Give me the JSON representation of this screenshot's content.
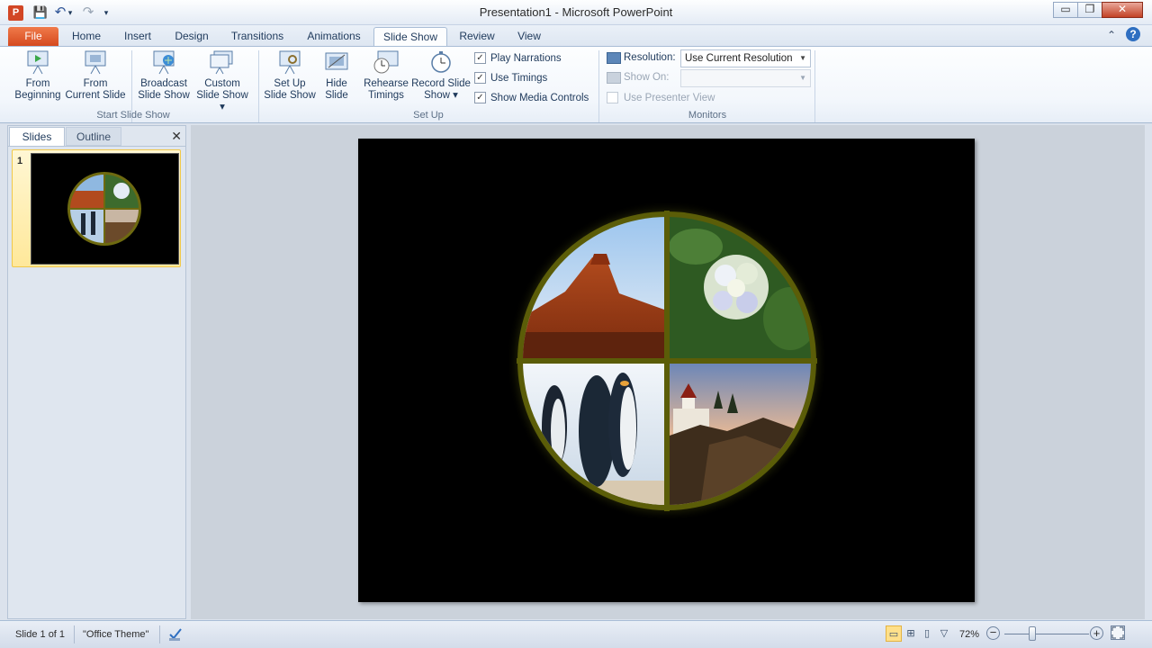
{
  "window": {
    "title": "Presentation1  -  Microsoft PowerPoint",
    "app_icon": "P",
    "controls": {
      "minimize": "▭",
      "restore": "❐",
      "close": "✕"
    }
  },
  "qat": {
    "save": "💾",
    "undo": "↶",
    "undo_dd": "▾",
    "redo": "↷",
    "more": "▾"
  },
  "tabs": [
    {
      "label": "File"
    },
    {
      "label": "Home"
    },
    {
      "label": "Insert"
    },
    {
      "label": "Design"
    },
    {
      "label": "Transitions"
    },
    {
      "label": "Animations"
    },
    {
      "label": "Slide Show"
    },
    {
      "label": "Review"
    },
    {
      "label": "View"
    }
  ],
  "ribbon_right": {
    "minimize_icon": "⌃",
    "help_icon": "?"
  },
  "ribbon": {
    "start_group": {
      "label": "Start Slide Show",
      "from_beginning": [
        "From",
        "Beginning"
      ],
      "from_current": [
        "From",
        "Current Slide"
      ],
      "broadcast": [
        "Broadcast",
        "Slide Show"
      ],
      "custom": [
        "Custom",
        "Slide Show ▾"
      ]
    },
    "setup_group": {
      "label": "Set Up",
      "setup": [
        "Set Up",
        "Slide Show"
      ],
      "hide": [
        "Hide",
        "Slide"
      ],
      "rehearse": [
        "Rehearse",
        "Timings"
      ],
      "record": [
        "Record Slide",
        "Show ▾"
      ],
      "play_narrations": "Play Narrations",
      "use_timings": "Use Timings",
      "show_media_controls": "Show Media Controls",
      "checked": [
        "✓",
        "✓",
        "✓"
      ]
    },
    "monitors_group": {
      "label": "Monitors",
      "resolution_label": "Resolution:",
      "resolution_value": "Use Current Resolution",
      "show_on_label": "Show On:",
      "show_on_value": "",
      "presenter_view": "Use Presenter View"
    }
  },
  "left_pane": {
    "tab_slides": "Slides",
    "tab_outline": "Outline",
    "close": "✕",
    "slide_number": "1"
  },
  "status": {
    "slide_info": "Slide 1 of 1",
    "theme": "\"Office Theme\"",
    "zoom": "72%",
    "zoom_out": "−",
    "zoom_in": "+",
    "colors": {
      "accent": "#d4471c"
    }
  }
}
